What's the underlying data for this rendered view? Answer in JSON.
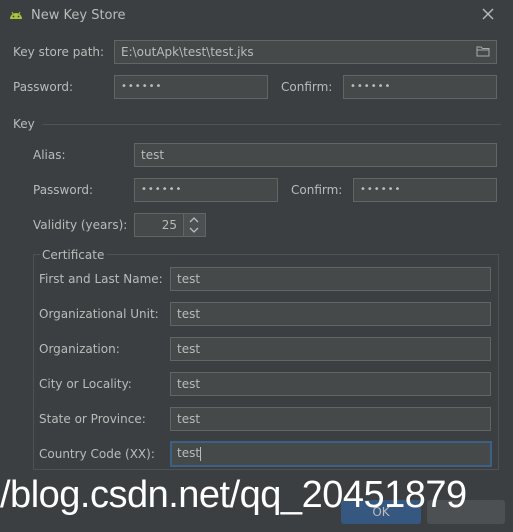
{
  "window": {
    "title": "New Key Store"
  },
  "keystore": {
    "path_label": "Key store path:",
    "path_value": "E:\\outApk\\test\\test.jks",
    "password_label": "Password:",
    "password_value": "••••••",
    "confirm_label": "Confirm:",
    "confirm_value": "••••••"
  },
  "key": {
    "section_label": "Key",
    "alias_label": "Alias:",
    "alias_value": "test",
    "password_label": "Password:",
    "password_value": "••••••",
    "confirm_label": "Confirm:",
    "confirm_value": "••••••",
    "validity_label": "Validity (years):",
    "validity_value": "25"
  },
  "certificate": {
    "section_label": "Certificate",
    "first_last_label": "First and Last Name:",
    "first_last_value": "test",
    "org_unit_label": "Organizational Unit:",
    "org_unit_value": "test",
    "org_label": "Organization:",
    "org_value": "test",
    "city_label": "City or Locality:",
    "city_value": "test",
    "state_label": "State or Province:",
    "state_value": "test",
    "country_label": "Country Code (XX):",
    "country_value": "test"
  },
  "footer": {
    "ok_label": "OK",
    "watermark": "/blog.csdn.net/qq_20451879"
  },
  "colors": {
    "background": "#3c3f41",
    "field_bg": "#45494a",
    "field_border": "#646464",
    "focus_border": "#3d6185",
    "android_green": "#a4c639"
  },
  "icons": [
    "android-icon",
    "close-icon",
    "folder-icon",
    "chevron-up-icon",
    "chevron-down-icon"
  ]
}
